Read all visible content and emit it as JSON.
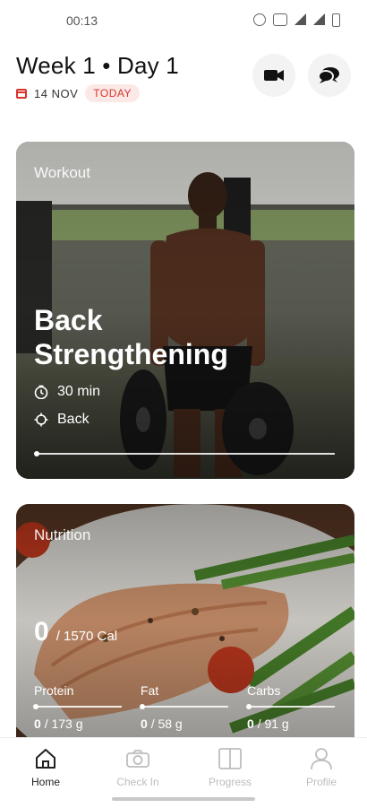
{
  "status_bar": {
    "time": "00:13"
  },
  "header": {
    "title": "Week 1 • Day 1",
    "date": "14 NOV",
    "today_badge": "TODAY"
  },
  "workout_card": {
    "label": "Workout",
    "title_line1": "Back",
    "title_line2": "Strengthening",
    "duration": "30 min",
    "focus_area": "Back",
    "progress": 0
  },
  "nutrition_card": {
    "label": "Nutrition",
    "calories_consumed": "0",
    "calories_goal": "/ 1570 Cal",
    "macros": [
      {
        "label": "Protein",
        "consumed": "0",
        "goal": "/ 173 g"
      },
      {
        "label": "Fat",
        "consumed": "0",
        "goal": "/ 58 g"
      },
      {
        "label": "Carbs",
        "consumed": "0",
        "goal": "/ 91 g"
      }
    ]
  },
  "bottom_nav": {
    "items": [
      {
        "label": "Home",
        "icon": "home-icon",
        "active": true
      },
      {
        "label": "Check In",
        "icon": "camera-icon",
        "active": false
      },
      {
        "label": "Progress",
        "icon": "book-icon",
        "active": false
      },
      {
        "label": "Profile",
        "icon": "person-icon",
        "active": false
      }
    ]
  },
  "colors": {
    "accent": "#d9342b",
    "active_nav": "#222222",
    "inactive_nav": "#bdbdbd"
  }
}
